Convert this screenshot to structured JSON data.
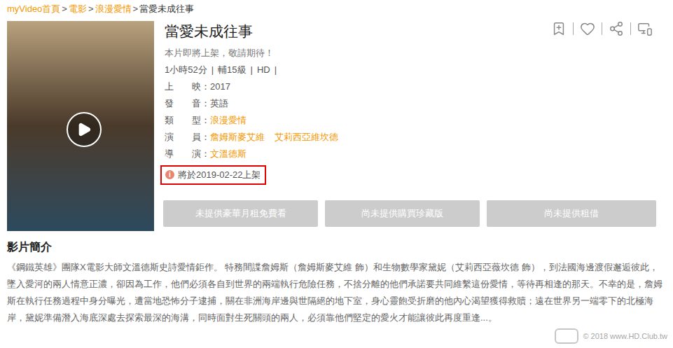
{
  "breadcrumb": {
    "separator": ">",
    "items": [
      {
        "label": "myVideo首頁",
        "link": true
      },
      {
        "label": "電影",
        "link": true
      },
      {
        "label": "浪漫愛情",
        "link": true
      },
      {
        "label": "當愛未成往事",
        "link": false
      }
    ]
  },
  "title": "當愛未成往事",
  "status_text": "本片即將上架，敬請期待！",
  "meta": {
    "separator": "|",
    "items": [
      "1小時52分",
      "輔15級",
      "HD"
    ]
  },
  "details": [
    {
      "label": "上　　映：",
      "values": [
        {
          "text": "2017",
          "link": false
        }
      ]
    },
    {
      "label": "發　　音：",
      "values": [
        {
          "text": "英語",
          "link": false
        }
      ]
    },
    {
      "label": "類　　型：",
      "values": [
        {
          "text": "浪漫愛情",
          "link": true
        }
      ]
    },
    {
      "label": "演　　員：",
      "values": [
        {
          "text": "詹姆斯麥艾維",
          "link": true
        },
        {
          "text": "艾莉西亞維坎德",
          "link": true
        }
      ]
    },
    {
      "label": "導　　演：",
      "values": [
        {
          "text": "文溫德斯",
          "link": true
        }
      ]
    }
  ],
  "notice": {
    "icon": "i",
    "text": "將於2019-02-22上架",
    "highlighted": true
  },
  "buttons": [
    {
      "label": "未提供豪華月租免費看",
      "disabled": true
    },
    {
      "label": "尚未提供購買珍藏版",
      "disabled": true
    },
    {
      "label": "尚未提供租借",
      "disabled": true
    }
  ],
  "synopsis": {
    "heading": "影片簡介",
    "body": "《鋼鐵英雄》團隊X電影大師文溫德斯史詩愛情鉅作。 特務間諜詹姆斯（詹姆斯麥艾維 飾）和生物數學家黛妮（艾莉西亞薇坎德 飾），到法國海邊渡假邂逅彼此，墜入愛河的兩人情意正濃，卻因為工作，他們必須各自到世界的兩端執行危險任務，不捨分離的他們承諾要共同維繫這份愛情，等待再相逢的那天。不幸的是，詹姆斯在執行任務過程中身分曝光，遭當地恐怖分子逮捕，關在非洲海岸邊與世隔絕的地下室，身心靈飽受折磨的他內心渴望獲得救贖；遠在世界另一端零下的北極海岸，黛妮準備潛入海底深處去探索最深的海溝，同時面對生死關頭的兩人，必須靠他們堅定的愛火才能讓彼此再度重逢...。"
  },
  "watermark": {
    "text": "© 2018 www.HD.Club.tw"
  }
}
